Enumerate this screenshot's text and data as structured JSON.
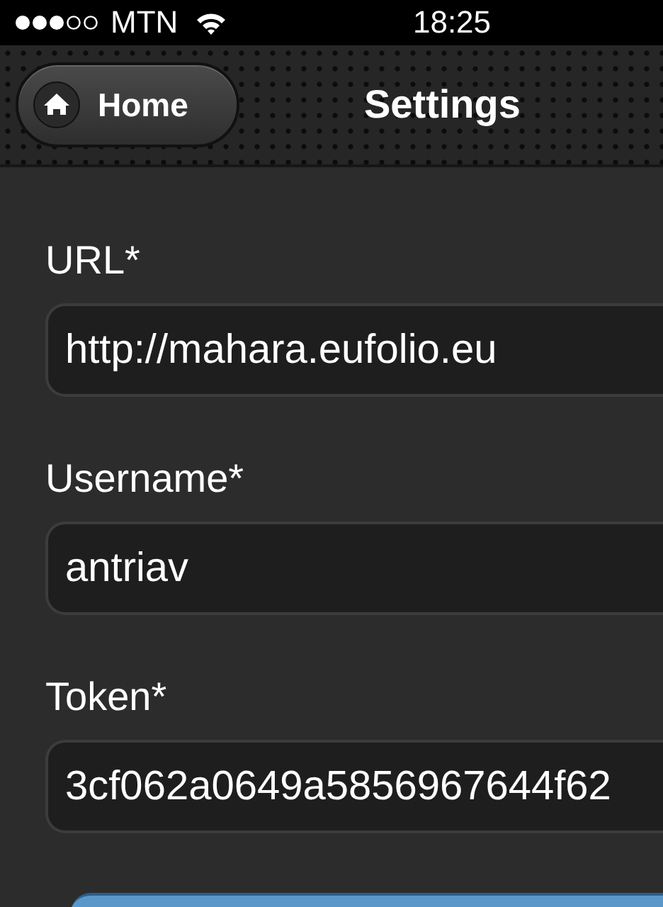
{
  "status_bar": {
    "carrier": "MTN",
    "time": "18:25"
  },
  "nav_bar": {
    "back_button": "Home",
    "title": "Settings"
  },
  "fields": [
    {
      "label": "URL*",
      "value": "http://mahara.eufolio.eu"
    },
    {
      "label": "Username*",
      "value": "antriav"
    },
    {
      "label": "Token*",
      "value": "3cf062a0649a5856967644f62"
    }
  ]
}
